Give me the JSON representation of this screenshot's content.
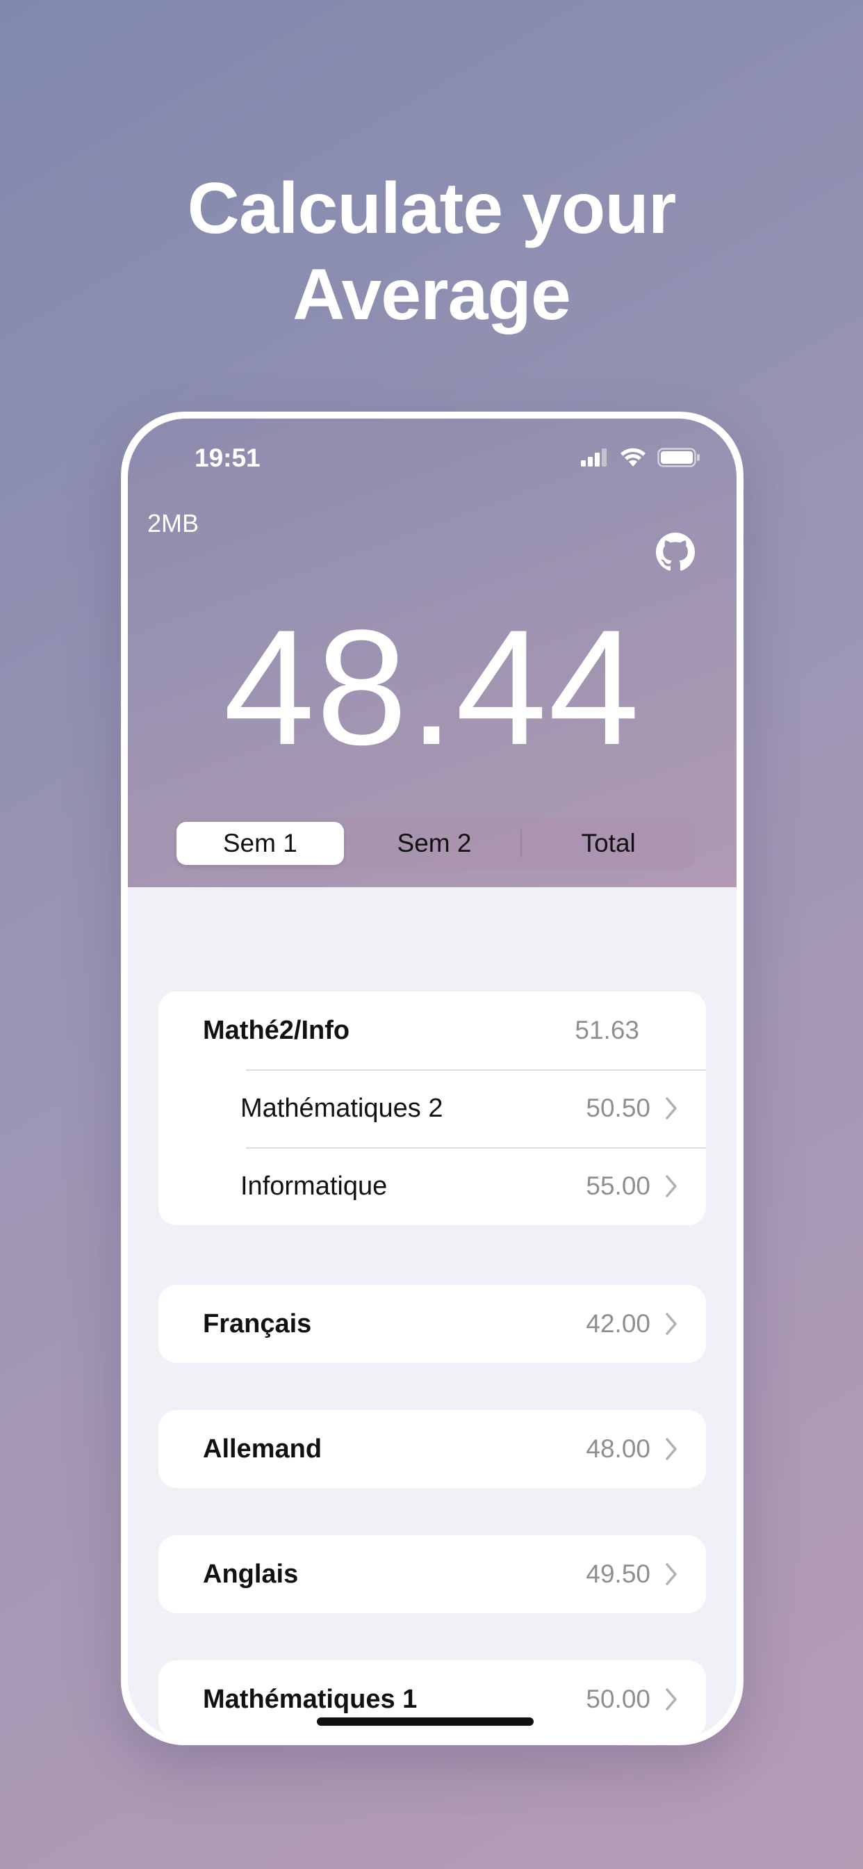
{
  "headline": {
    "line1": "Calculate your",
    "line2": "Average"
  },
  "status_bar": {
    "time": "19:51",
    "icons": [
      "cellular-signal-icon",
      "wifi-icon",
      "battery-icon"
    ]
  },
  "header": {
    "storage": "2MB",
    "github_icon": "github-icon",
    "average": "48.44"
  },
  "segments": {
    "items": [
      "Sem 1",
      "Sem 2",
      "Total"
    ],
    "selected": "Sem 1"
  },
  "groups": [
    {
      "name": "Mathé2/Info",
      "value": "51.63",
      "subjects": [
        {
          "name": "Mathématiques 2",
          "value": "50.50"
        },
        {
          "name": "Informatique",
          "value": "55.00"
        }
      ]
    }
  ],
  "subjects": [
    {
      "name": "Français",
      "value": "42.00"
    },
    {
      "name": "Allemand",
      "value": "48.00"
    },
    {
      "name": "Anglais",
      "value": "49.50"
    },
    {
      "name": "Mathématiques 1",
      "value": "50.00"
    }
  ],
  "colors": {
    "accent_text": "#ffffff",
    "value_gray": "#8e8e93",
    "list_background": "#f1f0f6"
  }
}
